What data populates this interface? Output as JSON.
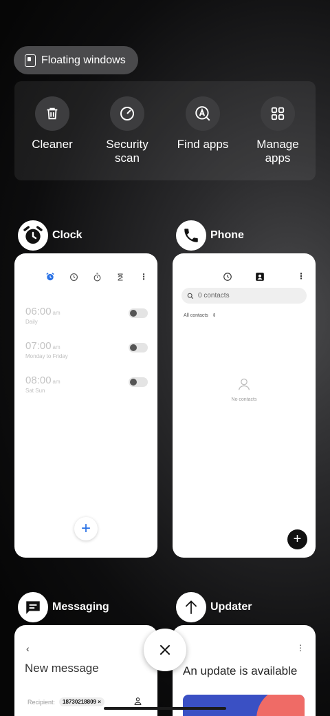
{
  "floating_windows": {
    "label": "Floating windows",
    "icon": "floating-window-icon"
  },
  "tools": [
    {
      "label": "Cleaner",
      "icon": "trash-icon"
    },
    {
      "label": "Security\nscan",
      "icon": "security-scan-icon"
    },
    {
      "label": "Find apps",
      "icon": "find-apps-icon"
    },
    {
      "label": "Manage\napps",
      "icon": "grid-icon"
    }
  ],
  "cards": {
    "clock": {
      "name": "Clock",
      "alarms": [
        {
          "time": "06:00",
          "ampm": "am",
          "repeat": "Daily"
        },
        {
          "time": "07:00",
          "ampm": "am",
          "repeat": "Monday to Friday"
        },
        {
          "time": "08:00",
          "ampm": "am",
          "repeat": "Sat Sun"
        }
      ],
      "fab": "+"
    },
    "phone": {
      "name": "Phone",
      "search_placeholder": "0 contacts",
      "filter": "All contacts",
      "empty": "No contacts",
      "fab": "+"
    },
    "messaging": {
      "name": "Messaging",
      "back": "‹",
      "title": "New message",
      "recipient_label": "Recipient:",
      "recipient_chip": "18730218809 ×"
    },
    "updater": {
      "name": "Updater",
      "menu": "⋮",
      "title": "An update is available"
    }
  },
  "close": {
    "icon": "close-icon"
  },
  "colors": {
    "accent_blue": "#2a72e6",
    "tile_bg": "#3d3d3f"
  }
}
